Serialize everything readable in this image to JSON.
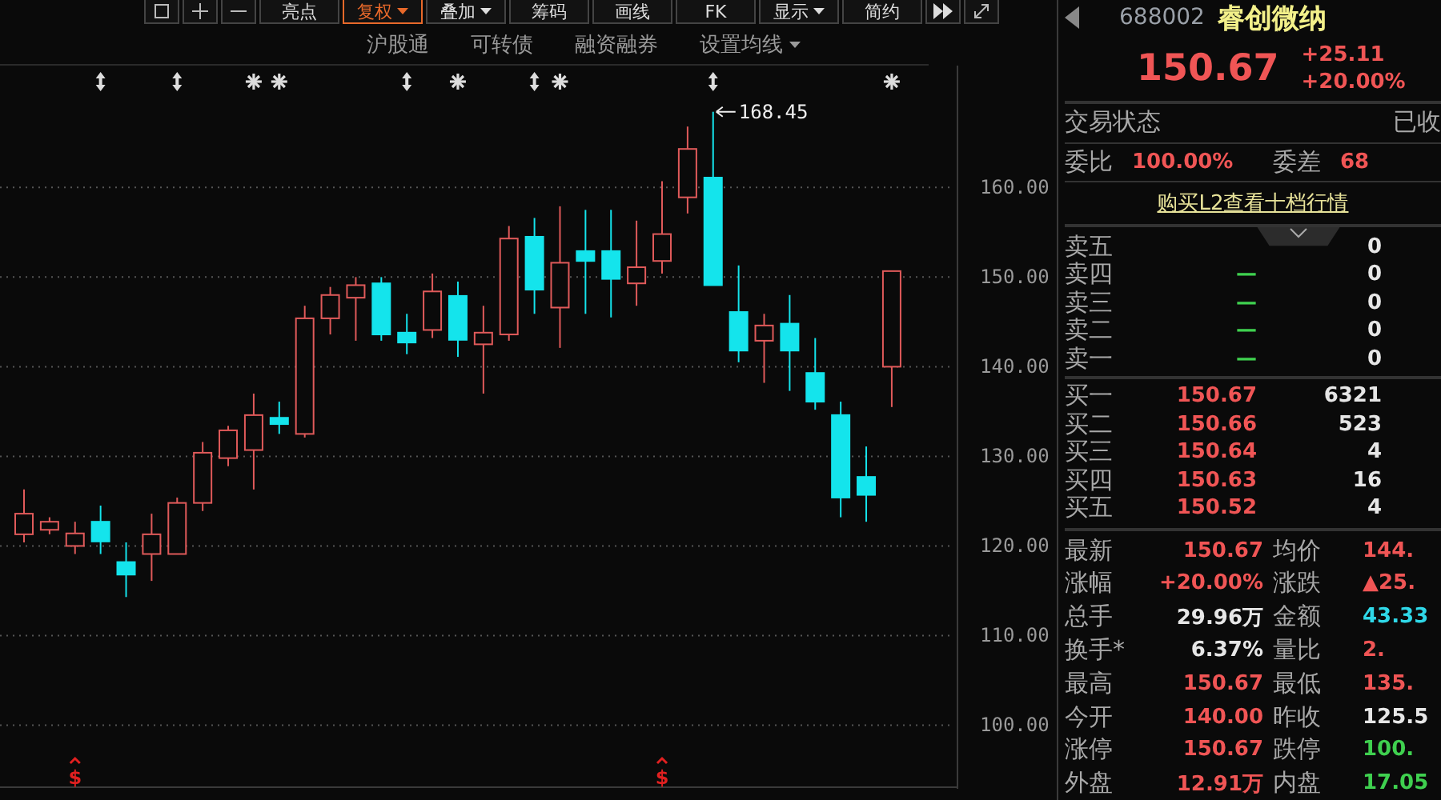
{
  "toolbar": {
    "buttons": [
      {
        "label": "亮点",
        "dropdown": false,
        "selected": false
      },
      {
        "label": "复权",
        "dropdown": true,
        "selected": true
      },
      {
        "label": "叠加",
        "dropdown": true,
        "selected": false
      },
      {
        "label": "筹码",
        "dropdown": false,
        "selected": false
      },
      {
        "label": "画线",
        "dropdown": false,
        "selected": false
      },
      {
        "label": "FK",
        "dropdown": false,
        "selected": false
      },
      {
        "label": "显示",
        "dropdown": true,
        "selected": false
      },
      {
        "label": "简约",
        "dropdown": false,
        "selected": false
      }
    ]
  },
  "chart_tabs": [
    {
      "label": "沪股通",
      "dropdown": false
    },
    {
      "label": "可转债",
      "dropdown": false
    },
    {
      "label": "融资融券",
      "dropdown": false
    },
    {
      "label": "设置均线",
      "dropdown": true
    }
  ],
  "chart": {
    "chart_data": {
      "type": "candlestick",
      "grid": true,
      "ylim": [
        92.9,
        173.6
      ],
      "yticks": [
        {
          "value": 160,
          "label": "160.00"
        },
        {
          "value": 150,
          "label": "150.00"
        },
        {
          "value": 140,
          "label": "140.00"
        },
        {
          "value": 130,
          "label": "130.00"
        },
        {
          "value": 120,
          "label": "120.00"
        },
        {
          "value": 110,
          "label": "110.00"
        },
        {
          "value": 100,
          "label": "100.00"
        }
      ],
      "ohlc": [
        [
          121.3,
          126.3,
          120.4,
          123.6
        ],
        [
          121.8,
          123.2,
          121.3,
          122.7
        ],
        [
          120,
          122.7,
          119.1,
          121.4
        ],
        [
          122.7,
          124.5,
          119.1,
          120.5
        ],
        [
          118.2,
          120.4,
          114.3,
          116.8
        ],
        [
          119.1,
          123.6,
          116.1,
          121.3
        ],
        [
          119.1,
          125.4,
          119.1,
          124.8
        ],
        [
          124.8,
          131.6,
          123.9,
          130.4
        ],
        [
          129.8,
          133.4,
          128.9,
          132.9
        ],
        [
          130.7,
          137,
          126.3,
          134.6
        ],
        [
          134.3,
          136.1,
          132.5,
          133.6
        ],
        [
          132.5,
          146.8,
          132.1,
          145.4
        ],
        [
          145.4,
          148.9,
          143.6,
          148
        ],
        [
          147.7,
          150,
          142.9,
          149.1
        ],
        [
          149.3,
          150,
          142.9,
          143.6
        ],
        [
          143.8,
          145.9,
          141.4,
          142.7
        ],
        [
          144.1,
          150.4,
          143.2,
          148.4
        ],
        [
          147.9,
          149.5,
          141.1,
          143
        ],
        [
          142.5,
          146.8,
          137,
          143.8
        ],
        [
          143.6,
          155.7,
          142.9,
          154.3
        ],
        [
          154.5,
          156.6,
          145.9,
          148.6
        ],
        [
          146.6,
          157.9,
          142.1,
          151.6
        ],
        [
          152.9,
          157.5,
          145.9,
          151.8
        ],
        [
          152.9,
          157.5,
          145.5,
          149.8
        ],
        [
          149.3,
          156.3,
          146.8,
          151.1
        ],
        [
          151.8,
          160.7,
          150.4,
          154.8
        ],
        [
          158.9,
          166.8,
          157.1,
          164.3
        ],
        [
          161.1,
          168.45,
          149.1,
          149.1
        ],
        [
          146.1,
          151.3,
          140.5,
          141.8
        ],
        [
          142.9,
          145.9,
          138.2,
          144.6
        ],
        [
          144.8,
          148,
          137.3,
          141.8
        ],
        [
          139.3,
          143.2,
          135.2,
          136.1
        ],
        [
          134.6,
          136.1,
          123.2,
          125.4
        ],
        [
          127.7,
          131.1,
          122.7,
          125.7
        ],
        [
          140,
          150.67,
          135.5,
          150.67
        ]
      ]
    },
    "marks": [
      {
        "kind": "plain"
      },
      {
        "kind": "plain"
      },
      {
        "kind": "signal",
        "label": "$"
      },
      {
        "kind": "split"
      },
      {
        "kind": "plain"
      },
      {
        "kind": "plain"
      },
      {
        "kind": "split"
      },
      {
        "kind": "plain"
      },
      {
        "kind": "plain"
      },
      {
        "kind": "star"
      },
      {
        "kind": "star"
      },
      {
        "kind": "plain"
      },
      {
        "kind": "plain"
      },
      {
        "kind": "plain"
      },
      {
        "kind": "plain"
      },
      {
        "kind": "split"
      },
      {
        "kind": "plain"
      },
      {
        "kind": "star"
      },
      {
        "kind": "plain"
      },
      {
        "kind": "plain"
      },
      {
        "kind": "split"
      },
      {
        "kind": "star"
      },
      {
        "kind": "plain"
      },
      {
        "kind": "plain"
      },
      {
        "kind": "plain"
      },
      {
        "kind": "signal",
        "label": "$"
      },
      {
        "kind": "plain"
      },
      {
        "kind": "split_high",
        "label": "168.45"
      },
      {
        "kind": "plain"
      },
      {
        "kind": "plain"
      },
      {
        "kind": "plain"
      },
      {
        "kind": "plain"
      },
      {
        "kind": "plain"
      },
      {
        "kind": "plain"
      },
      {
        "kind": "star"
      }
    ]
  },
  "quote": {
    "code": "688002",
    "name": "睿创微纳",
    "price": "150.67",
    "change": "+25.11",
    "change_pct": "+20.00%"
  },
  "status": {
    "label": "交易状态",
    "value": "已收"
  },
  "ratio": [
    {
      "label": "委比",
      "value": "100.00%"
    },
    {
      "label": "委差",
      "value": "68"
    }
  ],
  "l2_link": "购买L2查看十档行情",
  "asks": [
    {
      "label": "卖五",
      "volume": "0"
    },
    {
      "label": "卖四",
      "price": "—",
      "volume": "0"
    },
    {
      "label": "卖三",
      "price": "—",
      "volume": "0"
    },
    {
      "label": "卖二",
      "price": "—",
      "volume": "0"
    },
    {
      "label": "卖一",
      "price": "—",
      "volume": "0"
    }
  ],
  "bids": [
    {
      "label": "买一",
      "price": "150.67",
      "volume": "6321"
    },
    {
      "label": "买二",
      "price": "150.66",
      "volume": "523"
    },
    {
      "label": "买三",
      "price": "150.64",
      "volume": "4"
    },
    {
      "label": "买四",
      "price": "150.63",
      "volume": "16"
    },
    {
      "label": "买五",
      "price": "150.52",
      "volume": "4"
    }
  ],
  "stats": [
    {
      "label": "最新",
      "value": "150.67",
      "color": "#f05555"
    },
    {
      "label": "均价",
      "value": "144.",
      "color": "#f05555"
    },
    {
      "label": "涨幅",
      "value": "+20.00%",
      "color": "#f05555"
    },
    {
      "label": "涨跌",
      "value": "▲25.",
      "color": "#f05555"
    },
    {
      "label": "总手",
      "value": "29.96万",
      "color": "#e6e6e6"
    },
    {
      "label": "金额",
      "value": "43.33",
      "color": "#2fd8e8"
    },
    {
      "label": "换手*",
      "value": "6.37%",
      "color": "#e6e6e6"
    },
    {
      "label": "量比",
      "value": "2.",
      "color": "#f05555"
    },
    {
      "label": "最高",
      "value": "150.67",
      "color": "#f05555"
    },
    {
      "label": "最低",
      "value": "135.",
      "color": "#f05555"
    },
    {
      "label": "今开",
      "value": "140.00",
      "color": "#f05555"
    },
    {
      "label": "昨收",
      "value": "125.5",
      "color": "#e6e6e6"
    },
    {
      "label": "涨停",
      "value": "150.67",
      "color": "#f05555"
    },
    {
      "label": "跌停",
      "value": "100.",
      "color": "#3fd04f"
    },
    {
      "label": "外盘",
      "value": "12.91万",
      "color": "#f05555"
    },
    {
      "label": "内盘",
      "value": "17.05",
      "color": "#3fd04f"
    }
  ]
}
